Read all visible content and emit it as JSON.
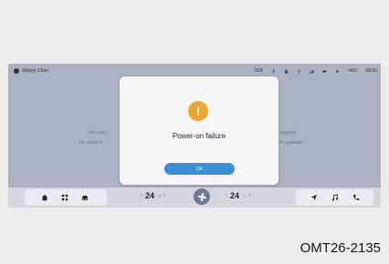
{
  "status_bar": {
    "user_name": "Stephy Chan",
    "right_items": [
      "O24",
      "",
      "",
      "",
      "",
      "",
      "",
      "-45C",
      "09:30"
    ],
    "icons": [
      "timer-icon",
      "bluetooth-icon",
      "lock-icon",
      "wifi-icon",
      "signal-icon",
      "battery-icon",
      "bell-icon",
      "thermometer-icon",
      "clock-icon"
    ]
  },
  "background_text": {
    "left_line1": "the curre",
    "left_line2": "he owner is",
    "right_line1": "upgrade",
    "right_line2": "ile upgrade"
  },
  "dialog": {
    "icon": "warning-icon",
    "icon_glyph": "!",
    "title": "Power-on failure",
    "ok_label": "OK"
  },
  "dock": {
    "left_icons": [
      "home-icon",
      "apps-icon",
      "car-icon"
    ],
    "right_icons": [
      "navigation-icon",
      "music-icon",
      "phone-icon"
    ],
    "left_temp": {
      "value": "24",
      "unit": "°C"
    },
    "right_temp": {
      "value": "24",
      "unit": "°C"
    },
    "decrease_glyph": "‹",
    "increase_glyph": "›",
    "fan_icon": "fan-icon"
  },
  "caption": "OMT26-2135",
  "colors": {
    "screen_bg": "#a9b2c2",
    "accent": "#3a8fd9",
    "warning": "#f0a52e"
  }
}
